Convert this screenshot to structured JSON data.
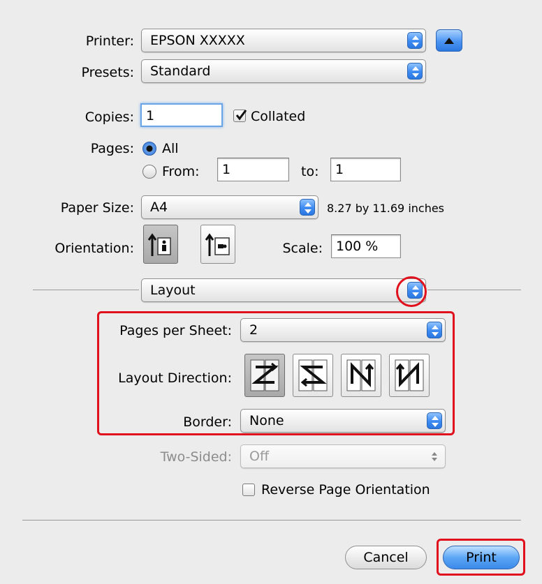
{
  "printer": {
    "label": "Printer:",
    "value": "EPSON XXXXX"
  },
  "presets": {
    "label": "Presets:",
    "value": "Standard"
  },
  "copies": {
    "label": "Copies:",
    "value": "1",
    "collated_label": "Collated",
    "collated": true
  },
  "pages": {
    "label": "Pages:",
    "all_label": "All",
    "from_label": "From:",
    "from_value": "1",
    "to_label": "to:",
    "to_value": "1",
    "selected": "All"
  },
  "paper_size": {
    "label": "Paper Size:",
    "value": "A4",
    "dimensions": "8.27 by 11.69 inches"
  },
  "orientation": {
    "label": "Orientation:",
    "selected": "portrait"
  },
  "scale": {
    "label": "Scale:",
    "value": "100 %"
  },
  "section": {
    "value": "Layout"
  },
  "layout": {
    "pages_per_sheet_label": "Pages per Sheet:",
    "pages_per_sheet_value": "2",
    "direction_label": "Layout Direction:",
    "directions": [
      "z-left-right",
      "z-right-left",
      "n-down-left",
      "n-down-right"
    ],
    "selected_direction": "z-left-right",
    "border_label": "Border:",
    "border_value": "None"
  },
  "two_sided": {
    "label": "Two-Sided:",
    "value": "Off",
    "enabled": false
  },
  "reverse": {
    "label": "Reverse Page Orientation",
    "checked": false
  },
  "buttons": {
    "cancel": "Cancel",
    "print": "Print"
  },
  "colors": {
    "highlight": "#e0101c",
    "accent": "#3b89ea"
  }
}
